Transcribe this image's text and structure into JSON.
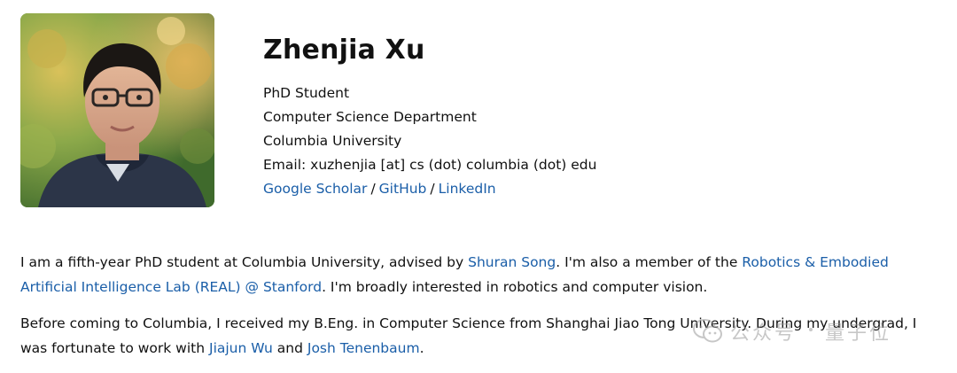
{
  "profile": {
    "name": "Zhenjia Xu",
    "title": "PhD Student",
    "department": "Computer Science Department",
    "university": "Columbia University",
    "email": "Email: xuzhenjia [at] cs (dot) columbia (dot) edu",
    "links": {
      "google_scholar": "Google Scholar",
      "github": "GitHub",
      "linkedin": "LinkedIn",
      "separator": "/"
    }
  },
  "bio": {
    "p1": {
      "t1": "I am a fifth-year PhD student at Columbia University, advised by ",
      "link1": "Shuran Song",
      "t2": ". I'm also a member of the ",
      "link2": "Robotics & Embodied Artificial Intelligence Lab (REAL) @ Stanford",
      "t3": ". I'm broadly interested in robotics and computer vision."
    },
    "p2": {
      "t1": "Before coming to Columbia, I received my B.Eng. in Computer Science from Shanghai Jiao Tong University. During my undergrad, I was fortunate to work with ",
      "link1": "Jiajun Wu",
      "t2": " and ",
      "link2": "Josh Tenenbaum",
      "t3": "."
    }
  },
  "watermark": {
    "left": "公众号",
    "right": "量子位"
  },
  "colors": {
    "link": "#1a5ea8",
    "text": "#111111"
  }
}
